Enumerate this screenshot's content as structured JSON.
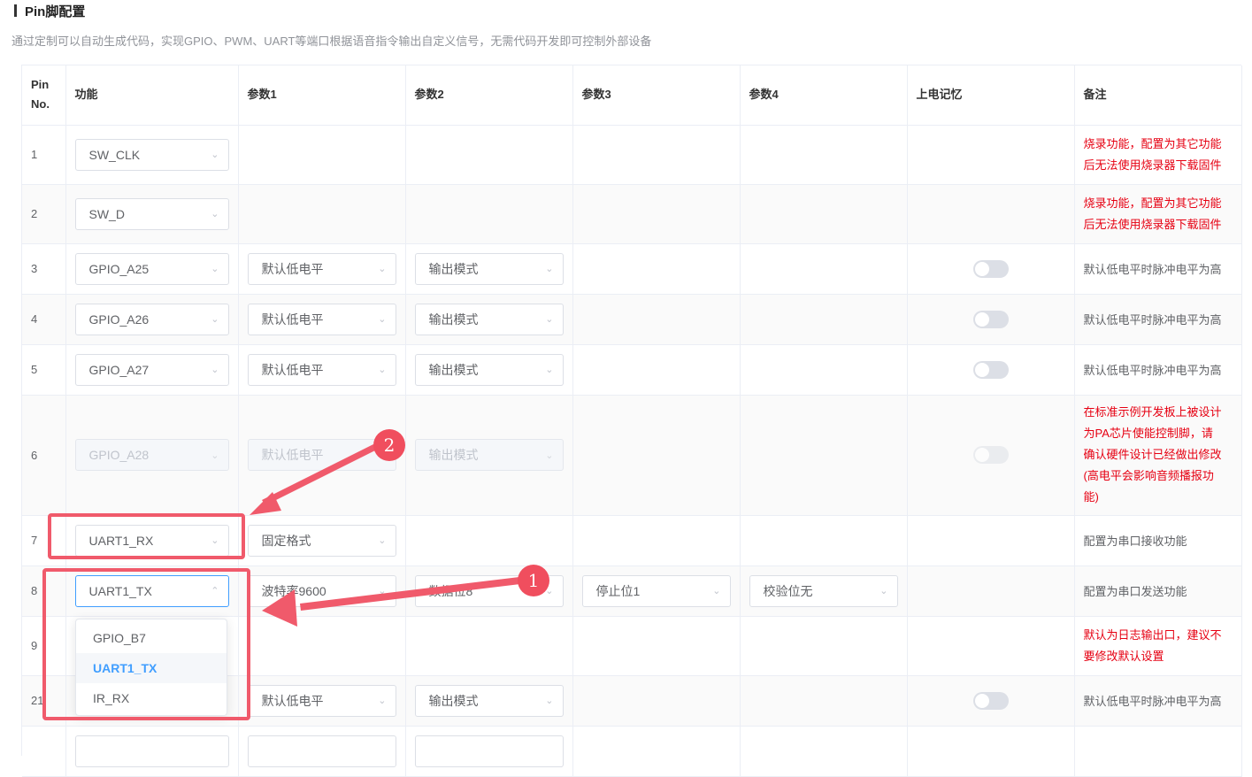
{
  "page": {
    "title": "Pin脚配置",
    "subtitle": "通过定制可以自动生成代码，实现GPIO、PWM、UART等端口根据语音指令输出自定义信号，无需代码开发即可控制外部设备"
  },
  "table": {
    "headers": {
      "pin_line1": "Pin",
      "pin_line2": "No.",
      "func": "功能",
      "p1": "参数1",
      "p2": "参数2",
      "p3": "参数3",
      "p4": "参数4",
      "memory": "上电记忆",
      "note": "备注"
    },
    "rows": [
      {
        "pin": "1",
        "func": "SW_CLK",
        "note1": "烧录功能，配置为其它功能",
        "note2": "后无法使用烧录器下载固件"
      },
      {
        "pin": "2",
        "func": "SW_D",
        "note1": "烧录功能，配置为其它功能",
        "note2": "后无法使用烧录器下载固件"
      },
      {
        "pin": "3",
        "func": "GPIO_A25",
        "p1": "默认低电平",
        "p2": "输出模式",
        "note": "默认低电平时脉冲电平为高"
      },
      {
        "pin": "4",
        "func": "GPIO_A26",
        "p1": "默认低电平",
        "p2": "输出模式",
        "note": "默认低电平时脉冲电平为高"
      },
      {
        "pin": "5",
        "func": "GPIO_A27",
        "p1": "默认低电平",
        "p2": "输出模式",
        "note": "默认低电平时脉冲电平为高"
      },
      {
        "pin": "6",
        "func": "GPIO_A28",
        "p1": "默认低电平",
        "p2": "输出模式",
        "note_lines": [
          "在标准示例开发板上被设计",
          "为PA芯片使能控制脚，请",
          "确认硬件设计已经做出修改",
          "(高电平会影响音频播报功",
          "能)"
        ]
      },
      {
        "pin": "7",
        "func": "UART1_RX",
        "p1": "固定格式",
        "note": "配置为串口接收功能"
      },
      {
        "pin": "8",
        "func": "UART1_TX",
        "p1": "波特率9600",
        "p2": "数据位8",
        "p3": "停止位1",
        "p4": "校验位无",
        "note": "配置为串口发送功能"
      },
      {
        "pin": "9",
        "note1": "默认为日志输出口，建议不",
        "note2": "要修改默认设置"
      },
      {
        "pin": "21",
        "p1": "默认低电平",
        "p2": "输出模式",
        "note": "默认低电平时脉冲电平为高"
      }
    ]
  },
  "dropdown": {
    "options": [
      "GPIO_B7",
      "UART1_TX",
      "IR_RX"
    ],
    "selected": "UART1_TX"
  },
  "annotations": {
    "badge1": "1",
    "badge2": "2",
    "color": "#f05a6b"
  },
  "colors": {
    "accent": "#409eff",
    "warning_text": "#e60012"
  }
}
